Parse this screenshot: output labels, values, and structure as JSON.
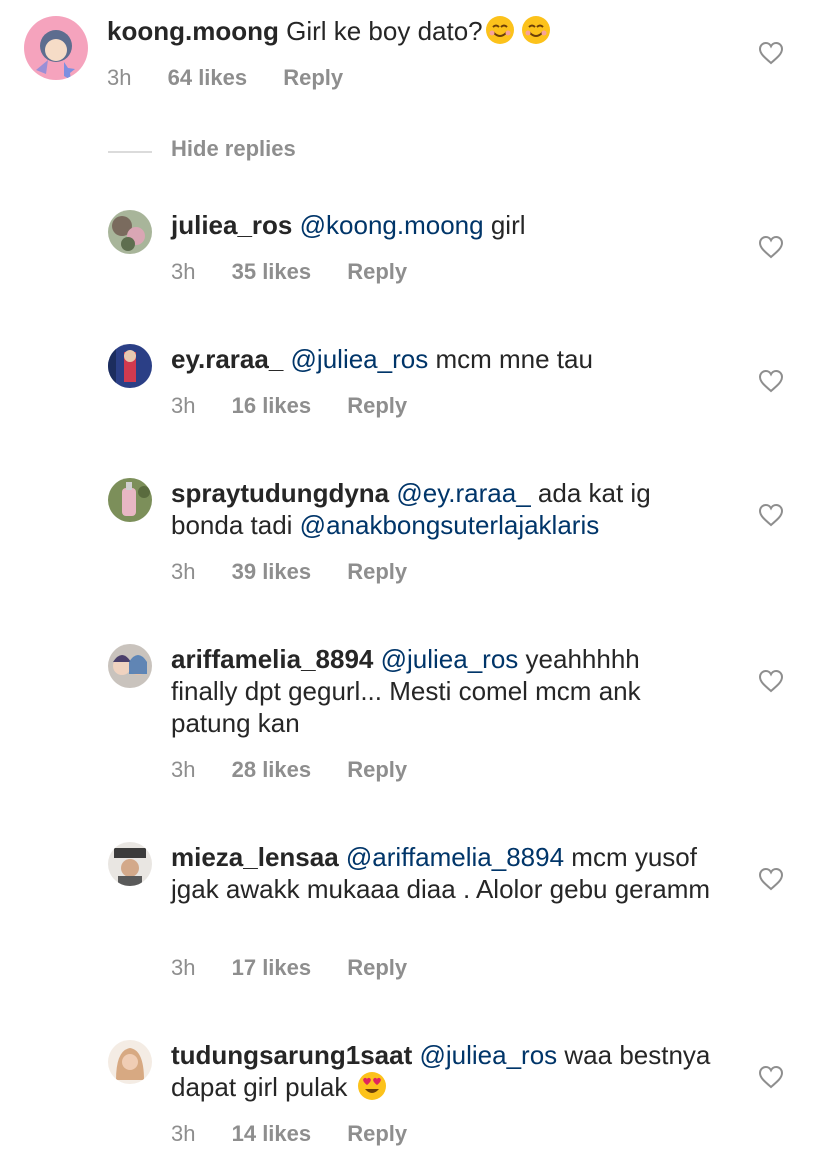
{
  "top_comment": {
    "username": "koong.moong",
    "text": "Girl ke boy dato?",
    "emojis": [
      "smiling-face-emoji",
      "smiling-face-emoji"
    ],
    "time": "3h",
    "likes": "64 likes",
    "reply": "Reply"
  },
  "hide_replies_label": "Hide replies",
  "replies": [
    {
      "username": "juliea_ros",
      "mention": "@koong.moong",
      "text": " girl",
      "time": "3h",
      "likes": "35 likes",
      "reply": "Reply"
    },
    {
      "username": "ey.raraa_",
      "mention": "@juliea_ros",
      "text": " mcm mne tau",
      "time": "3h",
      "likes": "16 likes",
      "reply": "Reply"
    },
    {
      "username": "spraytudungdyna",
      "mention": "@ey.raraa_",
      "text": " ada kat ig bonda tadi ",
      "mention2": "@anakbongsuterlajaklaris",
      "time": "3h",
      "likes": "39 likes",
      "reply": "Reply"
    },
    {
      "username": "ariffamelia_8894",
      "mention": "@juliea_ros",
      "text": " yeahhhhh finally dpt gegurl... Mesti comel mcm ank patung kan",
      "time": "3h",
      "likes": "28 likes",
      "reply": "Reply"
    },
    {
      "username": "mieza_lensaa",
      "mention": "@ariffamelia_8894",
      "text": " mcm yusof jgak awakk mukaaa diaa . Alolor gebu geramm",
      "time": "3h",
      "likes": "17 likes",
      "reply": "Reply"
    },
    {
      "username": "tudungsarung1saat",
      "mention": "@juliea_ros",
      "text": " waa bestnya dapat girl pulak ",
      "emoji": "heart-eyes-emoji",
      "time": "3h",
      "likes": "14 likes",
      "reply": "Reply"
    }
  ],
  "icons": {
    "like": "heart-outline-icon"
  },
  "colors": {
    "mention": "#003569",
    "meta": "#8e8e8e",
    "text": "#262626"
  }
}
